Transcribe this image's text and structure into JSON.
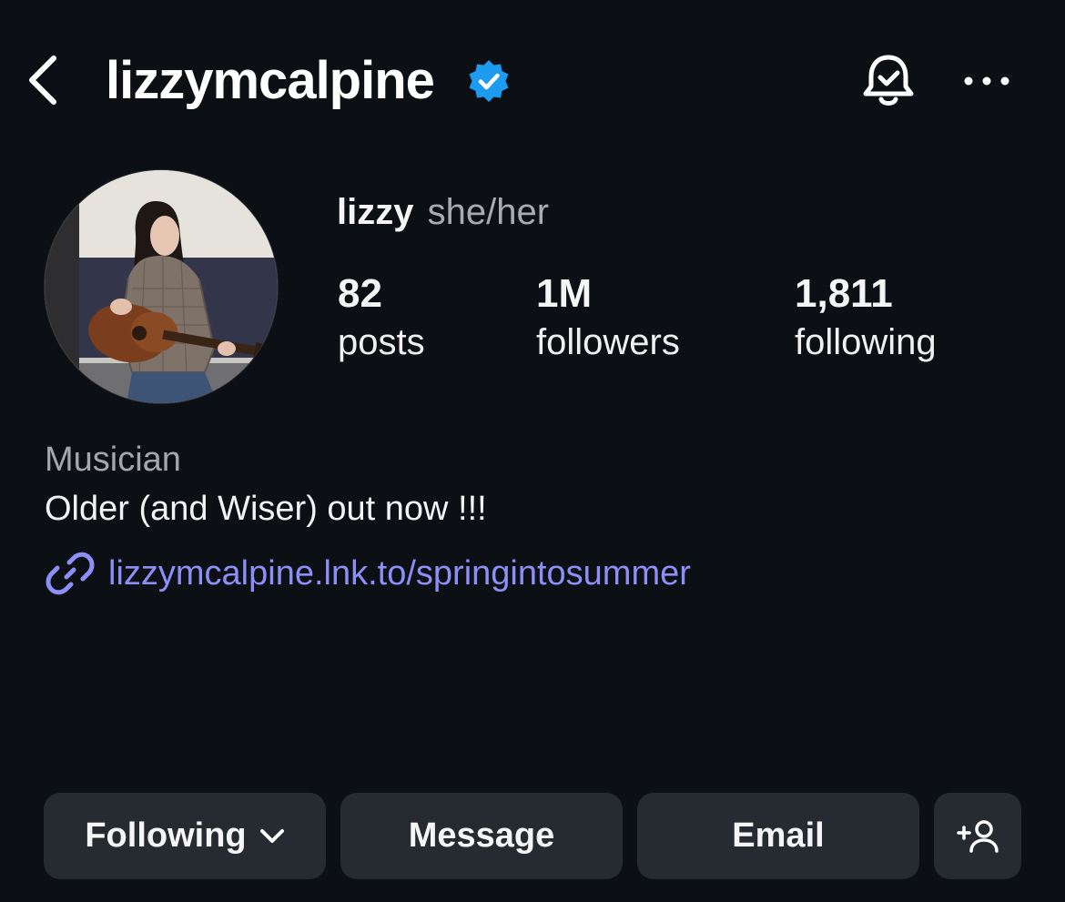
{
  "header": {
    "username": "lizzymcalpine",
    "verified": true,
    "icons": {
      "back": "back-chevron-icon",
      "verified": "verified-badge-icon",
      "notifications": "bell-check-icon",
      "more": "more-dots-icon"
    },
    "colors": {
      "verified_badge": "#1d9bf0",
      "background": "#0c0f14"
    }
  },
  "profile": {
    "display_name": "lizzy",
    "pronouns": "she/her",
    "stats": {
      "posts": {
        "value": "82",
        "label": "posts"
      },
      "followers": {
        "value": "1M",
        "label": "followers"
      },
      "following": {
        "value": "1,811",
        "label": "following"
      }
    }
  },
  "bio": {
    "category": "Musician",
    "text": "Older (and Wiser) out now !!!",
    "link": "lizzymcalpine.lnk.to/springintosummer",
    "link_icon": "link-chain-icon",
    "link_color": "#8c8ff5"
  },
  "actions": {
    "following_label": "Following",
    "message_label": "Message",
    "email_label": "Email",
    "add_icon": "add-person-icon",
    "button_color": "#262a31"
  }
}
